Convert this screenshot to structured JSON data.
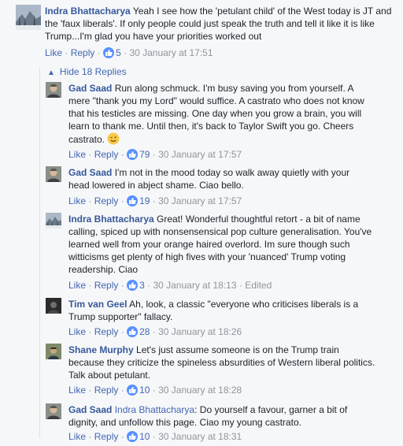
{
  "comments": [
    {
      "name": "Indra Bhattacharya",
      "text": "Yeah I see how the 'petulant child' of the West today is JT and the 'faux liberals'. If only people could just speak the truth and tell it like it is like Trump...I'm glad you have your priorities worked out",
      "like_label": "Like",
      "reply_label": "Reply",
      "likes": "5",
      "time": "30 January at 17:51",
      "edited": ""
    }
  ],
  "hide_replies_label": "Hide 18 Replies",
  "replies": [
    {
      "name": "Gad Saad",
      "text": "Run along schmuck. I'm busy saving you from yourself. A mere \"thank you my Lord\" would suffice. A castrato who does not know that his testicles are missing. One day when you grow a brain, you will learn to thank me. Until then, it's back to Taylor Swift you go. Cheers castrato.",
      "like_label": "Like",
      "reply_label": "Reply",
      "likes": "79",
      "time": "30 January at 17:57"
    },
    {
      "name": "Gad Saad",
      "text": "I'm not in the mood today so walk away quietly with your head lowered in abject shame. Ciao bello.",
      "like_label": "Like",
      "reply_label": "Reply",
      "likes": "19",
      "time": "30 January at 17:57"
    },
    {
      "name": "Indra Bhattacharya",
      "text": "Great! Wonderful thoughtful retort - a bit of name calling, spiced up with nonsensensical pop culture generalisation. You've learned well from your orange haired overlord. Im sure though such witticisms get plenty of high fives with your 'nuanced' Trump voting readership. Ciao",
      "like_label": "Like",
      "reply_label": "Reply",
      "likes": "3",
      "time": "30 January at 18:13",
      "edited": "Edited"
    },
    {
      "name": "Tim van Geel",
      "text": "Ah, look, a classic \"everyone who criticises liberals is a Trump supporter\" fallacy.",
      "like_label": "Like",
      "reply_label": "Reply",
      "likes": "28",
      "time": "30 January at 18:26"
    },
    {
      "name": "Shane Murphy",
      "text": "Let's just assume someone is on the Trump train because they criticize the spineless absurdities of Western liberal politics. Talk about petulant.",
      "like_label": "Like",
      "reply_label": "Reply",
      "likes": "10",
      "time": "30 January at 18:28"
    },
    {
      "name": "Gad Saad",
      "mention": "Indra Bhattacharya",
      "text": ": Do yourself a favour, garner a bit of dignity, and unfollow this page. Ciao my young castrato.",
      "like_label": "Like",
      "reply_label": "Reply",
      "likes": "10",
      "time": "30 January at 18:31"
    }
  ],
  "separator": "·",
  "colors": {
    "link": "#4267b2",
    "name": "#365899",
    "meta": "#90949c",
    "like_badge": "#5890ff"
  },
  "icons": {
    "like": "thumbs-up-icon",
    "emoji": "wink-emoji-icon",
    "hide": "caret-up-icon"
  }
}
